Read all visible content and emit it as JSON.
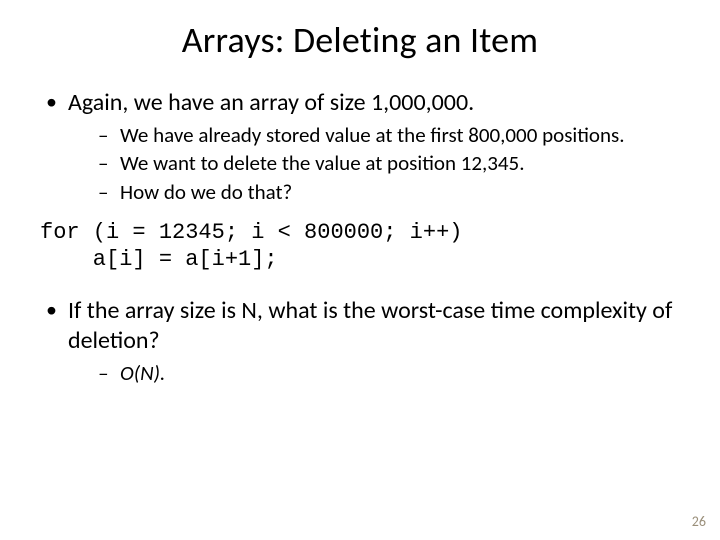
{
  "title": "Arrays: Deleting an Item",
  "b1": "Again, we have an array of size 1,000,000.",
  "b1s1": "We have already stored value at the first 800,000 positions.",
  "b1s2": "We want to delete the value at position 12,345.",
  "b1s3": "How do we do that?",
  "code1": "for (i = 12345; i < 800000; i++)",
  "code2": "    a[i] = a[i+1];",
  "b2": "If the array size is N, what is the worst-case time complexity of deletion?",
  "b2s1": "O(N).",
  "page": "26"
}
